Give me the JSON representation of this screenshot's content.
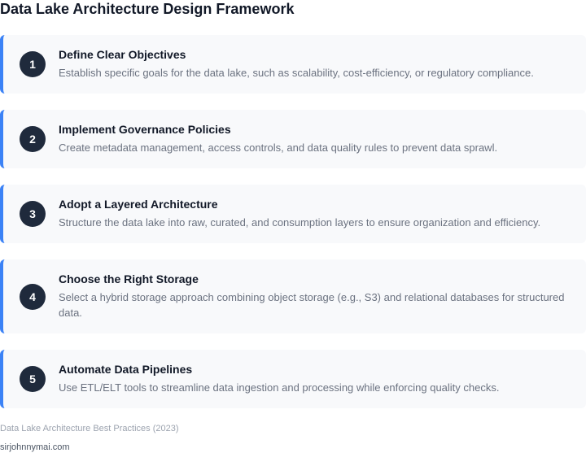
{
  "page": {
    "title": "Data Lake Architecture Design Framework"
  },
  "steps": [
    {
      "number": "1",
      "title": "Define Clear Objectives",
      "description": "Establish specific goals for the data lake, such as scalability, cost-efficiency, or regulatory compliance."
    },
    {
      "number": "2",
      "title": "Implement Governance Policies",
      "description": "Create metadata management, access controls, and data quality rules to prevent data sprawl."
    },
    {
      "number": "3",
      "title": "Adopt a Layered Architecture",
      "description": "Structure the data lake into raw, curated, and consumption layers to ensure organization and efficiency."
    },
    {
      "number": "4",
      "title": "Choose the Right Storage",
      "description": "Select a hybrid storage approach combining object storage (e.g., S3) and relational databases for structured data."
    },
    {
      "number": "5",
      "title": "Automate Data Pipelines",
      "description": "Use ETL/ELT tools to streamline data ingestion and processing while enforcing quality checks."
    }
  ],
  "footer": {
    "caption": "Data Lake Architecture Best Practices (2023)",
    "site": "sirjohnnymai.com"
  },
  "colors": {
    "accent": "#3b82f6",
    "badge": "#1f2a3c",
    "card_background": "#f8f9fb"
  }
}
